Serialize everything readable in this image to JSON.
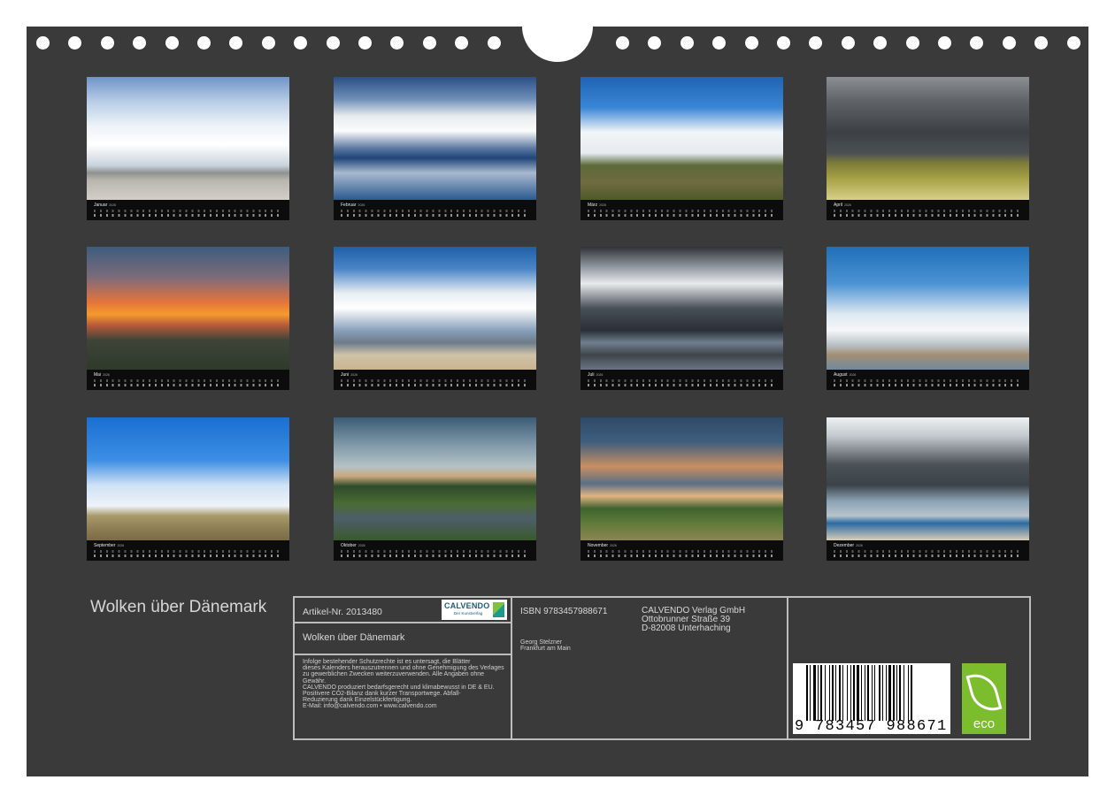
{
  "header": {
    "left_holes": 15,
    "right_holes": 15
  },
  "months": [
    {
      "label": "Januar",
      "year": "2026",
      "photo": "sky"
    },
    {
      "label": "Februar",
      "year": "2026",
      "photo": "mirror"
    },
    {
      "label": "März",
      "year": "2026",
      "photo": "dunes"
    },
    {
      "label": "April",
      "year": "2026",
      "photo": "storm"
    },
    {
      "label": "Mai",
      "year": "2026",
      "photo": "sunset"
    },
    {
      "label": "Juni",
      "year": "2026",
      "photo": "beach"
    },
    {
      "label": "Juli",
      "year": "2026",
      "photo": "dramatic"
    },
    {
      "label": "August",
      "year": "2026",
      "photo": "cirrus"
    },
    {
      "label": "September",
      "year": "2026",
      "photo": "hut"
    },
    {
      "label": "Oktober",
      "year": "2026",
      "photo": "canal"
    },
    {
      "label": "November",
      "year": "2026",
      "photo": "hill"
    },
    {
      "label": "Dezember",
      "year": "2026",
      "photo": "shelf"
    }
  ],
  "footer": {
    "title": "Wolken über Dänemark",
    "article": "Artikel-Nr. 2013480",
    "subtitle": "Wolken über Dänemark",
    "logo_name": "CALVENDO",
    "logo_sub": "Der Kunstverlag",
    "legal": [
      "Infolge bestehender Schutzrechte ist es untersagt, die Blätter",
      "dieses Kalenders herauszutrennen und ohne Genehmigung des Verlages",
      "zu gewerblichen Zwecken weiterzuverwenden. Alle Angaben ohne",
      "Gewähr.",
      "CALVENDO produziert bedarfsgerecht und klimabewusst in DE & EU.",
      "Positivere CO2-Bilanz dank kurzer Transportwege. Abfall-",
      "Reduzierung dank Einzelstückfertigung.",
      "E-Mail: info@calvendo.com • www.calvendo.com"
    ],
    "isbn": "ISBN 9783457988671",
    "author": "Georg Stelzner",
    "author_city": "Frankfurt am Main",
    "publisher": "CALVENDO Verlag GmbH",
    "street": "Ottobrunner Straße 39",
    "city": "D-82008 Unterhaching",
    "barcode_number": "9 783457 988671",
    "eco_label": "eco"
  },
  "colors": {
    "background": "#3a3a3a",
    "border": "#bdbdbd",
    "eco_green": "#7cbd2e"
  }
}
